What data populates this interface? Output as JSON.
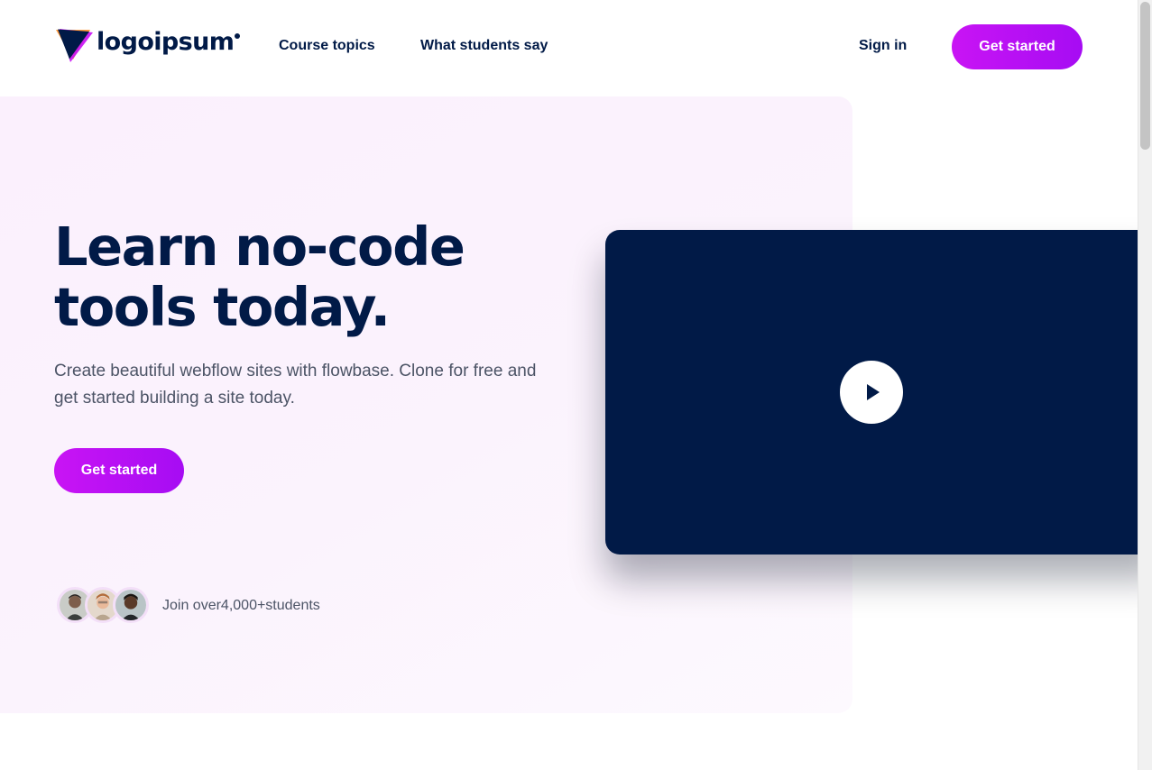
{
  "brand": {
    "logo_text": "logoipsum",
    "logo_icon": "triangle-play-logo-icon",
    "colors": {
      "navy": "#011a47",
      "purple": "#c914f4",
      "orange": "#ff8a2a",
      "hero_bg": "#fbf0fd"
    }
  },
  "nav": {
    "links": [
      "Course topics",
      "What students say"
    ],
    "sign_in": "Sign in",
    "cta": "Get started"
  },
  "hero": {
    "title_line1": "Learn no-code",
    "title_line2": "tools today.",
    "subtitle": "Create beautiful webflow sites with flowbase. Clone for free and get started building a site today.",
    "cta": "Get started",
    "social_proof": "Join over4,000+students",
    "avatars": [
      "student-avatar",
      "student-avatar",
      "student-avatar"
    ]
  },
  "video": {
    "play_icon": "play-icon"
  }
}
